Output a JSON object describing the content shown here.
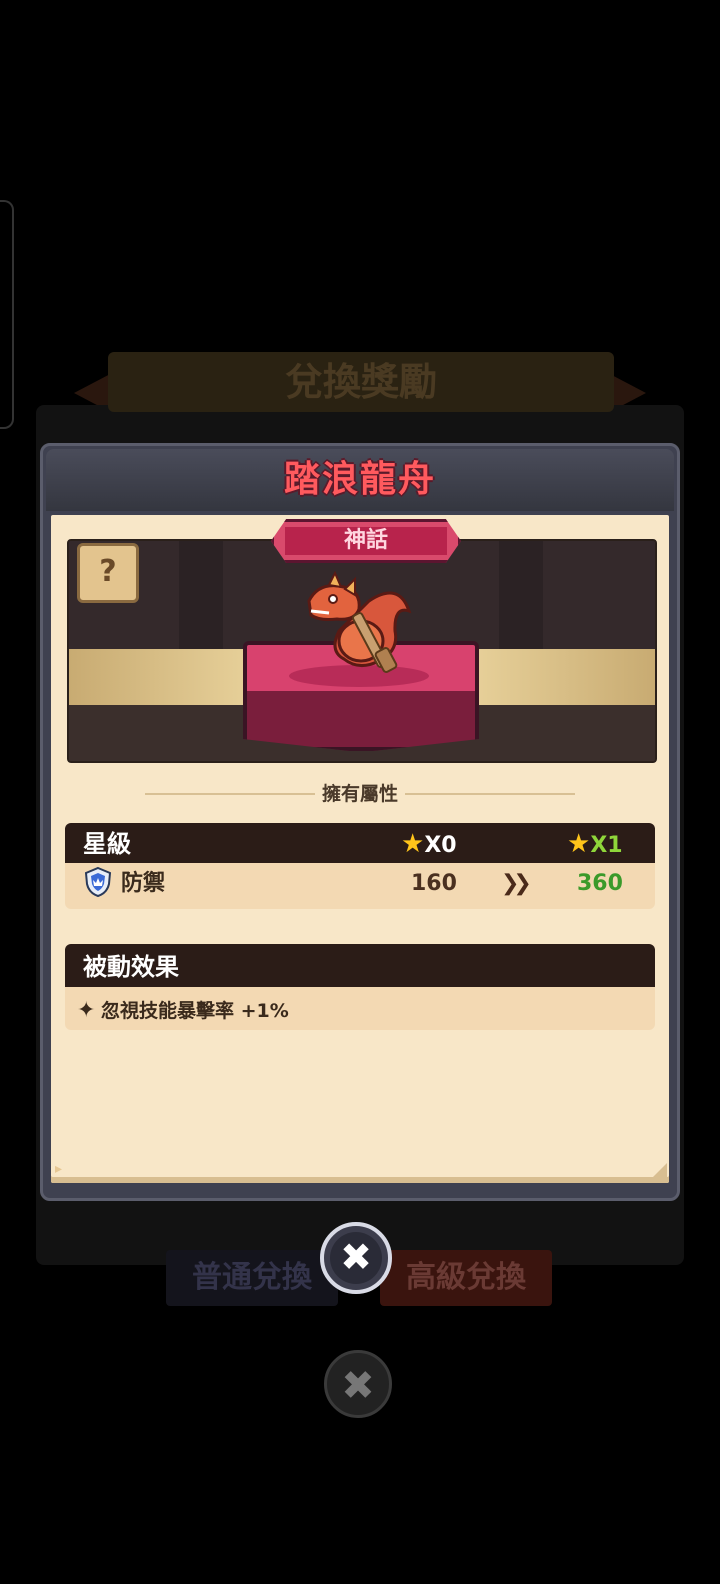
{
  "background": {
    "banner_title": "兌換獎勵",
    "tabs": [
      {
        "label": "普通兌換"
      },
      {
        "label": "高級兌換"
      }
    ],
    "close_icon": "close-icon"
  },
  "modal": {
    "title": "踏浪龍舟",
    "rarity": "神話",
    "help_icon": "book-question-icon",
    "preview_subject": "dragon-boat-character",
    "attributes_heading": "擁有屬性",
    "star_table": {
      "header_label": "星級",
      "from_star": "X0",
      "to_star": "X1",
      "row": {
        "icon": "shield-icon",
        "label": "防禦",
        "from_value": "160",
        "to_value": "360",
        "arrow_icon": "double-chevron-right-icon"
      }
    },
    "passive": {
      "title": "被動效果",
      "bullet_icon": "sparkle-icon",
      "text": "忽視技能暴擊率 +1%"
    },
    "close_icon": "close-icon"
  },
  "colors": {
    "title_red": "#ff5a5e",
    "rarity_pink": "#d94a6c",
    "star_yellow": "#ffc51a",
    "to_star_green": "#8fd63a",
    "to_value_green": "#3a9a2a",
    "parchment": "#f8e7c8",
    "dark_header": "#2b1c17"
  }
}
